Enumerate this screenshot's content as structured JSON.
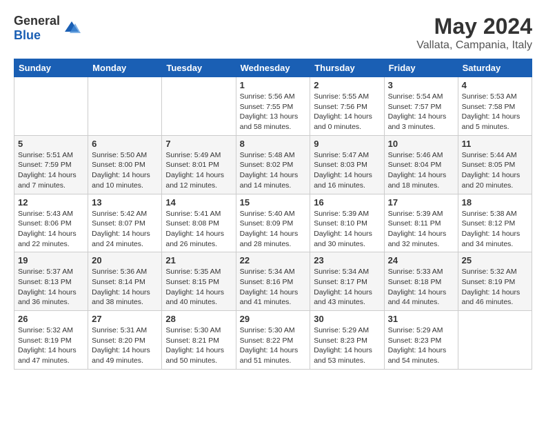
{
  "header": {
    "logo_general": "General",
    "logo_blue": "Blue",
    "month": "May 2024",
    "location": "Vallata, Campania, Italy"
  },
  "weekdays": [
    "Sunday",
    "Monday",
    "Tuesday",
    "Wednesday",
    "Thursday",
    "Friday",
    "Saturday"
  ],
  "weeks": [
    [
      {
        "day": "",
        "info": ""
      },
      {
        "day": "",
        "info": ""
      },
      {
        "day": "",
        "info": ""
      },
      {
        "day": "1",
        "info": "Sunrise: 5:56 AM\nSunset: 7:55 PM\nDaylight: 13 hours\nand 58 minutes."
      },
      {
        "day": "2",
        "info": "Sunrise: 5:55 AM\nSunset: 7:56 PM\nDaylight: 14 hours\nand 0 minutes."
      },
      {
        "day": "3",
        "info": "Sunrise: 5:54 AM\nSunset: 7:57 PM\nDaylight: 14 hours\nand 3 minutes."
      },
      {
        "day": "4",
        "info": "Sunrise: 5:53 AM\nSunset: 7:58 PM\nDaylight: 14 hours\nand 5 minutes."
      }
    ],
    [
      {
        "day": "5",
        "info": "Sunrise: 5:51 AM\nSunset: 7:59 PM\nDaylight: 14 hours\nand 7 minutes."
      },
      {
        "day": "6",
        "info": "Sunrise: 5:50 AM\nSunset: 8:00 PM\nDaylight: 14 hours\nand 10 minutes."
      },
      {
        "day": "7",
        "info": "Sunrise: 5:49 AM\nSunset: 8:01 PM\nDaylight: 14 hours\nand 12 minutes."
      },
      {
        "day": "8",
        "info": "Sunrise: 5:48 AM\nSunset: 8:02 PM\nDaylight: 14 hours\nand 14 minutes."
      },
      {
        "day": "9",
        "info": "Sunrise: 5:47 AM\nSunset: 8:03 PM\nDaylight: 14 hours\nand 16 minutes."
      },
      {
        "day": "10",
        "info": "Sunrise: 5:46 AM\nSunset: 8:04 PM\nDaylight: 14 hours\nand 18 minutes."
      },
      {
        "day": "11",
        "info": "Sunrise: 5:44 AM\nSunset: 8:05 PM\nDaylight: 14 hours\nand 20 minutes."
      }
    ],
    [
      {
        "day": "12",
        "info": "Sunrise: 5:43 AM\nSunset: 8:06 PM\nDaylight: 14 hours\nand 22 minutes."
      },
      {
        "day": "13",
        "info": "Sunrise: 5:42 AM\nSunset: 8:07 PM\nDaylight: 14 hours\nand 24 minutes."
      },
      {
        "day": "14",
        "info": "Sunrise: 5:41 AM\nSunset: 8:08 PM\nDaylight: 14 hours\nand 26 minutes."
      },
      {
        "day": "15",
        "info": "Sunrise: 5:40 AM\nSunset: 8:09 PM\nDaylight: 14 hours\nand 28 minutes."
      },
      {
        "day": "16",
        "info": "Sunrise: 5:39 AM\nSunset: 8:10 PM\nDaylight: 14 hours\nand 30 minutes."
      },
      {
        "day": "17",
        "info": "Sunrise: 5:39 AM\nSunset: 8:11 PM\nDaylight: 14 hours\nand 32 minutes."
      },
      {
        "day": "18",
        "info": "Sunrise: 5:38 AM\nSunset: 8:12 PM\nDaylight: 14 hours\nand 34 minutes."
      }
    ],
    [
      {
        "day": "19",
        "info": "Sunrise: 5:37 AM\nSunset: 8:13 PM\nDaylight: 14 hours\nand 36 minutes."
      },
      {
        "day": "20",
        "info": "Sunrise: 5:36 AM\nSunset: 8:14 PM\nDaylight: 14 hours\nand 38 minutes."
      },
      {
        "day": "21",
        "info": "Sunrise: 5:35 AM\nSunset: 8:15 PM\nDaylight: 14 hours\nand 40 minutes."
      },
      {
        "day": "22",
        "info": "Sunrise: 5:34 AM\nSunset: 8:16 PM\nDaylight: 14 hours\nand 41 minutes."
      },
      {
        "day": "23",
        "info": "Sunrise: 5:34 AM\nSunset: 8:17 PM\nDaylight: 14 hours\nand 43 minutes."
      },
      {
        "day": "24",
        "info": "Sunrise: 5:33 AM\nSunset: 8:18 PM\nDaylight: 14 hours\nand 44 minutes."
      },
      {
        "day": "25",
        "info": "Sunrise: 5:32 AM\nSunset: 8:19 PM\nDaylight: 14 hours\nand 46 minutes."
      }
    ],
    [
      {
        "day": "26",
        "info": "Sunrise: 5:32 AM\nSunset: 8:19 PM\nDaylight: 14 hours\nand 47 minutes."
      },
      {
        "day": "27",
        "info": "Sunrise: 5:31 AM\nSunset: 8:20 PM\nDaylight: 14 hours\nand 49 minutes."
      },
      {
        "day": "28",
        "info": "Sunrise: 5:30 AM\nSunset: 8:21 PM\nDaylight: 14 hours\nand 50 minutes."
      },
      {
        "day": "29",
        "info": "Sunrise: 5:30 AM\nSunset: 8:22 PM\nDaylight: 14 hours\nand 51 minutes."
      },
      {
        "day": "30",
        "info": "Sunrise: 5:29 AM\nSunset: 8:23 PM\nDaylight: 14 hours\nand 53 minutes."
      },
      {
        "day": "31",
        "info": "Sunrise: 5:29 AM\nSunset: 8:23 PM\nDaylight: 14 hours\nand 54 minutes."
      },
      {
        "day": "",
        "info": ""
      }
    ]
  ]
}
